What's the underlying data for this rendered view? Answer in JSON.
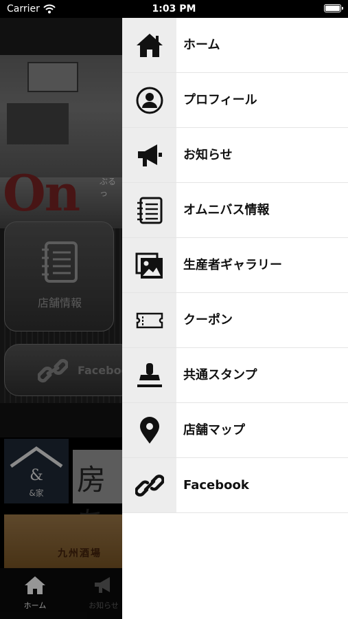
{
  "status_bar": {
    "carrier": "Carrier",
    "time": "1:03 PM"
  },
  "background": {
    "logo_text": "On",
    "logo_subtitle": "ぶるっ",
    "tile_label": "店舗情報",
    "pill_label": "Faceboo",
    "and_label": "&家",
    "calligraphy": "房ち",
    "banner_text": "九州酒場",
    "tabs": [
      {
        "label": "ホーム",
        "icon": "home-icon"
      },
      {
        "label": "お知らせ",
        "icon": "megaphone-icon"
      }
    ]
  },
  "drawer": {
    "items": [
      {
        "label": "ホーム",
        "icon": "home-icon"
      },
      {
        "label": "プロフィール",
        "icon": "profile-icon"
      },
      {
        "label": "お知らせ",
        "icon": "megaphone-icon"
      },
      {
        "label": "オムニバス情報",
        "icon": "notebook-icon"
      },
      {
        "label": "生産者ギャラリー",
        "icon": "gallery-icon"
      },
      {
        "label": "クーポン",
        "icon": "coupon-icon"
      },
      {
        "label": "共通スタンプ",
        "icon": "stamp-icon"
      },
      {
        "label": "店舗マップ",
        "icon": "map-pin-icon"
      },
      {
        "label": "Facebook",
        "icon": "link-icon"
      }
    ]
  }
}
